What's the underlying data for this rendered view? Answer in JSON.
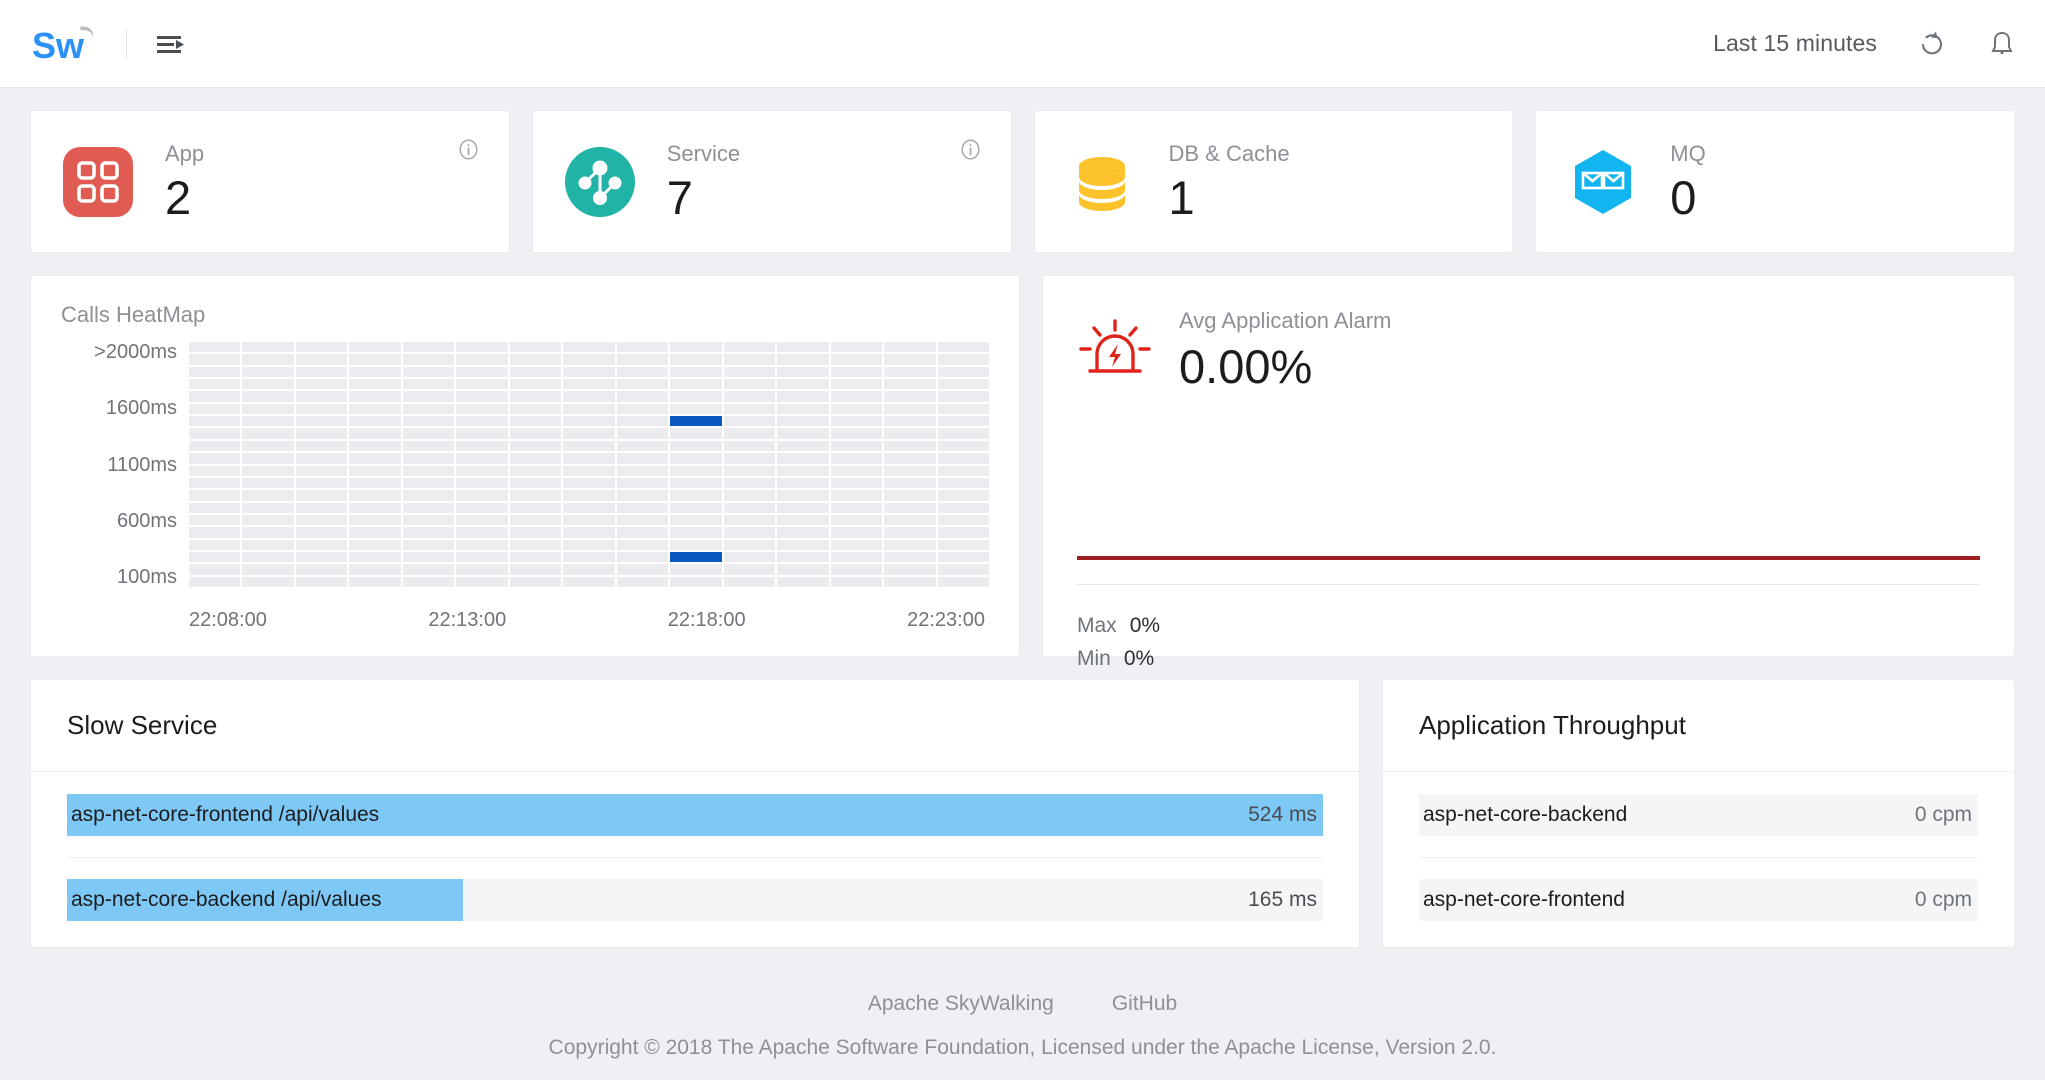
{
  "topbar": {
    "logo_text": "Sw",
    "menu_icon": "hamburger-list-icon",
    "time_range": "Last 15 minutes",
    "refresh_icon": "refresh-icon",
    "bell_icon": "bell-icon"
  },
  "stats": [
    {
      "label": "App",
      "value": "2",
      "icon": "app-grid-icon",
      "color": "#e05c52",
      "has_info": true
    },
    {
      "label": "Service",
      "value": "7",
      "icon": "service-nodes-icon",
      "color": "#21b3a6",
      "has_info": true
    },
    {
      "label": "DB & Cache",
      "value": "1",
      "icon": "database-icon",
      "color": "#fbc22a",
      "has_info": false
    },
    {
      "label": "MQ",
      "value": "0",
      "icon": "message-queue-icon",
      "color": "#12b5ef",
      "has_info": false
    }
  ],
  "heatmap": {
    "title": "Calls HeatMap"
  },
  "alarm": {
    "label": "Avg Application Alarm",
    "value": "0.00%",
    "icon": "alarm-siren-icon",
    "line_color": "#9e1f1f",
    "max_label": "Max",
    "max_value": "0%",
    "min_label": "Min",
    "min_value": "0%"
  },
  "slow_service": {
    "title": "Slow Service",
    "rows": [
      {
        "name": "asp-net-core-frontend /api/values",
        "value": "524 ms",
        "pct": 100
      },
      {
        "name": "asp-net-core-backend /api/values",
        "value": "165 ms",
        "pct": 31.5
      }
    ]
  },
  "throughput": {
    "title": "Application Throughput",
    "rows": [
      {
        "name": "asp-net-core-backend",
        "value": "0 cpm",
        "pct": 0
      },
      {
        "name": "asp-net-core-frontend",
        "value": "0 cpm",
        "pct": 0
      }
    ]
  },
  "footer": {
    "links": [
      {
        "label": "Apache SkyWalking"
      },
      {
        "label": "GitHub"
      }
    ],
    "copyright": "Copyright © 2018 The Apache Software Foundation, Licensed under the Apache License, Version 2.0."
  },
  "chart_data": [
    {
      "type": "heatmap",
      "title": "Calls HeatMap",
      "xlabel": "",
      "ylabel": "",
      "x_tick_labels": [
        "22:08:00",
        "22:13:00",
        "22:18:00",
        "22:23:00"
      ],
      "y_tick_labels": [
        ">2000ms",
        "1600ms",
        "1100ms",
        "600ms",
        "100ms"
      ],
      "columns": 15,
      "rows": 20,
      "empty_color": "#eaecef",
      "hot_color": "#0b59c0",
      "cells": [
        {
          "col": 9,
          "row": 6,
          "value": 1
        },
        {
          "col": 9,
          "row": 17,
          "value": 1
        }
      ]
    },
    {
      "type": "line",
      "title": "Avg Application Alarm",
      "series": [
        {
          "name": "Avg Application Alarm",
          "values": [
            0,
            0,
            0,
            0,
            0,
            0,
            0,
            0,
            0,
            0,
            0,
            0,
            0,
            0,
            0
          ]
        }
      ],
      "ylim": [
        0,
        0
      ],
      "ylabel": "%",
      "annotations": [
        "Max 0%",
        "Min 0%"
      ],
      "line_color": "#9e1f1f",
      "grid": false
    },
    {
      "type": "bar",
      "title": "Slow Service",
      "categories": [
        "asp-net-core-frontend /api/values",
        "asp-net-core-backend /api/values"
      ],
      "values": [
        524,
        165
      ],
      "unit": "ms",
      "ylabel": "",
      "xlabel": "",
      "bar_color": "#7ec8f5"
    },
    {
      "type": "bar",
      "title": "Application Throughput",
      "categories": [
        "asp-net-core-backend",
        "asp-net-core-frontend"
      ],
      "values": [
        0,
        0
      ],
      "unit": "cpm",
      "ylabel": "",
      "xlabel": "",
      "bar_color": "#7ec8f5"
    }
  ]
}
